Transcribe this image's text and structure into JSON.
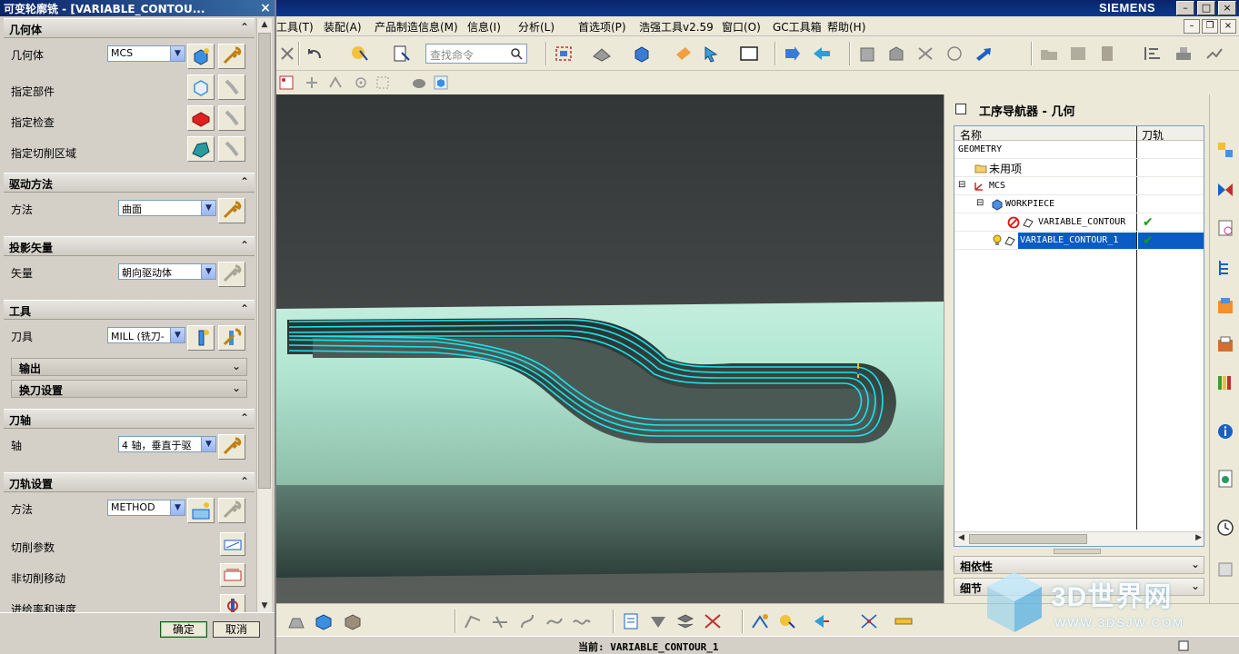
{
  "app": {
    "brand": "SIEMENS",
    "window_controls": [
      "–",
      "□",
      "×"
    ]
  },
  "menu": {
    "items": [
      "工具(T)",
      "装配(A)",
      "产品制造信息(M)",
      "信息(I)",
      "分析(L)",
      "首选项(P)",
      "浩强工具v2.59",
      "窗口(O)",
      "GC工具箱",
      "帮助(H)"
    ],
    "mdi_controls": [
      "–",
      "❐",
      "×"
    ]
  },
  "toolbar": {
    "search_placeholder": "查找命令"
  },
  "dialog": {
    "title": "可变轮廓铣 - [VARIABLE_CONTOU...",
    "close": "×",
    "sections": {
      "geometry": {
        "title": "几何体",
        "geometry_label": "几何体",
        "geometry_value": "MCS",
        "specify_part": "指定部件",
        "specify_check": "指定检查",
        "specify_cut_area": "指定切削区域"
      },
      "drive": {
        "title": "驱动方法",
        "method_label": "方法",
        "method_value": "曲面"
      },
      "projection": {
        "title": "投影矢量",
        "vector_label": "矢量",
        "vector_value": "朝向驱动体"
      },
      "tool": {
        "title": "工具",
        "tool_label": "刀具",
        "tool_value": "MILL (铣刀-",
        "output": "输出",
        "tool_change": "换刀设置"
      },
      "tool_axis": {
        "title": "刀轴",
        "axis_label": "轴",
        "axis_value": "4 轴，垂直于驱"
      },
      "path_settings": {
        "title": "刀轨设置",
        "method_label": "方法",
        "method_value": "METHOD",
        "cut_params": "切削参数",
        "non_cut_moves": "非切削移动",
        "feeds_speeds": "进给率和速度"
      }
    },
    "ok": "确定",
    "cancel": "取消"
  },
  "navigator": {
    "title": "工序导航器 - 几何",
    "col_name": "名称",
    "col_path": "刀轨",
    "rows": [
      {
        "label": "GEOMETRY",
        "check": ""
      },
      {
        "label": "未用项",
        "check": ""
      },
      {
        "label": "MCS",
        "check": ""
      },
      {
        "label": "WORKPIECE",
        "check": ""
      },
      {
        "label": "VARIABLE_CONTOUR",
        "check": "✔"
      },
      {
        "label": "VARIABLE_CONTOUR_1",
        "check": "✔"
      }
    ],
    "panes": [
      "相依性",
      "细节"
    ]
  },
  "status": {
    "text": "当前: VARIABLE_CONTOUR_1"
  },
  "watermark": {
    "name": "3D世界网",
    "url": "WWW.3DSJW.COM"
  },
  "colors": {
    "toolpath": "#14e6ee",
    "selection": "#0a5cc2",
    "check": "#10a010",
    "stock": "#b6e6d3"
  }
}
